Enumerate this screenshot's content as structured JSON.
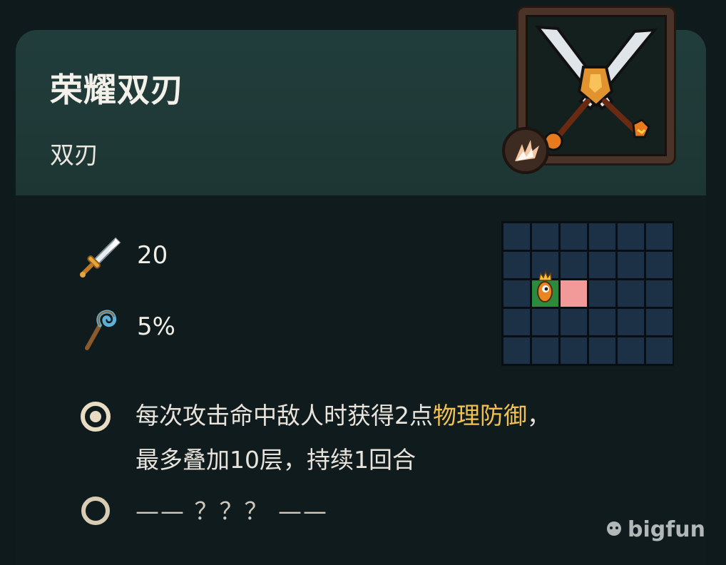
{
  "item": {
    "name": "荣耀双刃",
    "type": "双刃"
  },
  "stats": [
    {
      "icon": "sword-icon",
      "value": "20"
    },
    {
      "icon": "magic-staff-icon",
      "value": "5%"
    }
  ],
  "range_grid": {
    "rows": 5,
    "cols": 6,
    "player_cell": {
      "row": 2,
      "col": 1
    },
    "target_cells": [
      {
        "row": 2,
        "col": 2
      }
    ]
  },
  "abilities": [
    {
      "line1_prefix": "每次攻击命中敌人时获得2点",
      "line1_highlight": "物理防御",
      "line1_suffix": "，",
      "line2": "最多叠加10层，持续1回合"
    },
    {
      "locked_text": "—— ？？？ ——"
    }
  ],
  "watermark": "bigfun",
  "colors": {
    "highlight": "#f2c14e",
    "header_bg": "#213d3b",
    "grid_cell": "#1d3146",
    "player_cell": "#2b8a3e",
    "target_cell": "#f29a9a"
  }
}
